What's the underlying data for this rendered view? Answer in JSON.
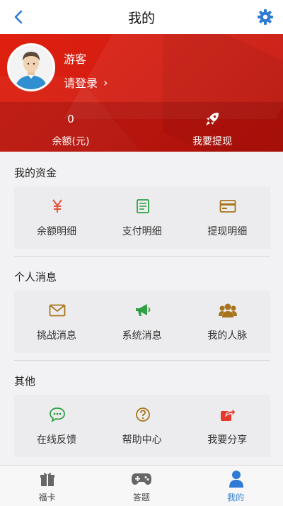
{
  "header": {
    "title": "我的",
    "back_icon": "chevron-left-icon",
    "settings_icon": "gear-icon"
  },
  "profile": {
    "name": "游客",
    "login_label": "请登录",
    "login_arrow": "›"
  },
  "stats": {
    "balance_value": "0",
    "balance_label": "余额(元)",
    "withdraw_label": "我要提现",
    "withdraw_icon": "rocket-icon"
  },
  "sections": [
    {
      "title": "我的资金",
      "items": [
        {
          "label": "余额明细",
          "icon": "yen-icon",
          "color": "#e8543c"
        },
        {
          "label": "支付明细",
          "icon": "bill-icon",
          "color": "#2ea043"
        },
        {
          "label": "提现明细",
          "icon": "card-icon",
          "color": "#a8741b"
        }
      ]
    },
    {
      "title": "个人消息",
      "items": [
        {
          "label": "挑战消息",
          "icon": "envelope-icon",
          "color": "#a8741b"
        },
        {
          "label": "系统消息",
          "icon": "megaphone-icon",
          "color": "#2ea043"
        },
        {
          "label": "我的人脉",
          "icon": "group-icon",
          "color": "#a8741b"
        }
      ]
    },
    {
      "title": "其他",
      "items": [
        {
          "label": "在线反馈",
          "icon": "chat-icon",
          "color": "#2ea043"
        },
        {
          "label": "帮助中心",
          "icon": "help-icon",
          "color": "#a8741b"
        },
        {
          "label": "我要分享",
          "icon": "share-icon",
          "color": "#e8382c"
        }
      ]
    }
  ],
  "tabs": [
    {
      "label": "福卡",
      "icon": "gift-icon",
      "active": false
    },
    {
      "label": "答题",
      "icon": "gamepad-icon",
      "active": false
    },
    {
      "label": "我的",
      "icon": "user-icon",
      "active": true
    }
  ],
  "colors": {
    "accent_blue": "#2e7bd6",
    "hero_red": "#d21c10",
    "tab_gray": "#666666"
  }
}
